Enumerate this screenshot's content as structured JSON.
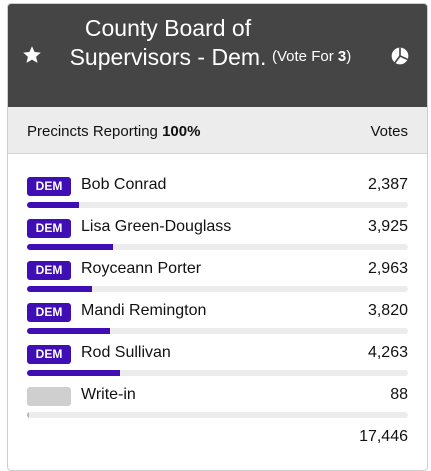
{
  "race": {
    "title": "County Board of Supervisors - Dem.",
    "vote_for_prefix": "(Vote For ",
    "vote_for_count": "3",
    "vote_for_suffix": ")",
    "icons": {
      "favorite": "star-icon",
      "results_chart": "pie-chart-icon"
    }
  },
  "reporting": {
    "label": "Precincts Reporting ",
    "percent": "100%",
    "votes_header": "Votes"
  },
  "candidates": [
    {
      "party": "DEM",
      "name": "Bob Conrad",
      "votes": "2,387",
      "share": 0.1368
    },
    {
      "party": "DEM",
      "name": "Lisa Green-Douglass",
      "votes": "3,925",
      "share": 0.225
    },
    {
      "party": "DEM",
      "name": "Royceann Porter",
      "votes": "2,963",
      "share": 0.1698
    },
    {
      "party": "DEM",
      "name": "Mandi Remington",
      "votes": "3,820",
      "share": 0.219
    },
    {
      "party": "DEM",
      "name": "Rod Sullivan",
      "votes": "4,263",
      "share": 0.2444
    },
    {
      "party": "",
      "name": "Write-in",
      "votes": "88",
      "share": 0.005
    }
  ],
  "total_votes": "17,446",
  "colors": {
    "header_bg": "#454545",
    "party_dem": "#3f0fb5",
    "bar_track": "#ececec",
    "write_in": "#cfcfcf"
  }
}
